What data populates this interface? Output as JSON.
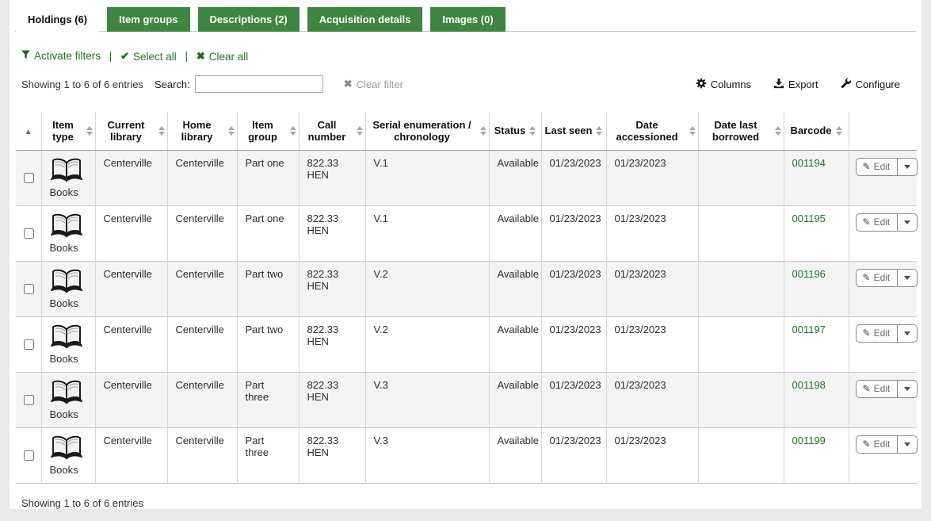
{
  "tabs": [
    {
      "label": "Holdings (6)",
      "active": true
    },
    {
      "label": "Item groups",
      "active": false
    },
    {
      "label": "Descriptions (2)",
      "active": false
    },
    {
      "label": "Acquisition details",
      "active": false
    },
    {
      "label": "Images (0)",
      "active": false
    }
  ],
  "filter_links": {
    "activate_filters": "Activate filters",
    "select_all": "Select all",
    "clear_all": "Clear all",
    "separator": "|"
  },
  "controls": {
    "showing": "Showing 1 to 6 of 6 entries",
    "search_label": "Search:",
    "search_value": "",
    "clear_filter": "Clear filter",
    "columns_button": "Columns",
    "export_button": "Export",
    "configure_button": "Configure"
  },
  "table": {
    "edit_label": "Edit",
    "columns": [
      "Item type",
      "Current library",
      "Home library",
      "Item group",
      "Call number",
      "Serial enumeration / chronology",
      "Status",
      "Last seen",
      "Date accessioned",
      "Date last borrowed",
      "Barcode"
    ],
    "rows": [
      {
        "item_type": "Books",
        "current_library": "Centerville",
        "home_library": "Centerville",
        "item_group": "Part one",
        "call_number": "822.33 HEN",
        "serial_enumeration": "V.1",
        "status": "Available",
        "last_seen": "01/23/2023",
        "date_accessioned": "01/23/2023",
        "date_last_borrowed": "",
        "barcode": "001194"
      },
      {
        "item_type": "Books",
        "current_library": "Centerville",
        "home_library": "Centerville",
        "item_group": "Part one",
        "call_number": "822.33 HEN",
        "serial_enumeration": "V.1",
        "status": "Available",
        "last_seen": "01/23/2023",
        "date_accessioned": "01/23/2023",
        "date_last_borrowed": "",
        "barcode": "001195"
      },
      {
        "item_type": "Books",
        "current_library": "Centerville",
        "home_library": "Centerville",
        "item_group": "Part two",
        "call_number": "822.33 HEN",
        "serial_enumeration": "V.2",
        "status": "Available",
        "last_seen": "01/23/2023",
        "date_accessioned": "01/23/2023",
        "date_last_borrowed": "",
        "barcode": "001196"
      },
      {
        "item_type": "Books",
        "current_library": "Centerville",
        "home_library": "Centerville",
        "item_group": "Part two",
        "call_number": "822.33 HEN",
        "serial_enumeration": "V.2",
        "status": "Available",
        "last_seen": "01/23/2023",
        "date_accessioned": "01/23/2023",
        "date_last_borrowed": "",
        "barcode": "001197"
      },
      {
        "item_type": "Books",
        "current_library": "Centerville",
        "home_library": "Centerville",
        "item_group": "Part three",
        "call_number": "822.33 HEN",
        "serial_enumeration": "V.3",
        "status": "Available",
        "last_seen": "01/23/2023",
        "date_accessioned": "01/23/2023",
        "date_last_borrowed": "",
        "barcode": "001198"
      },
      {
        "item_type": "Books",
        "current_library": "Centerville",
        "home_library": "Centerville",
        "item_group": "Part three",
        "call_number": "822.33 HEN",
        "serial_enumeration": "V.3",
        "status": "Available",
        "last_seen": "01/23/2023",
        "date_accessioned": "01/23/2023",
        "date_last_borrowed": "",
        "barcode": "001199"
      }
    ]
  },
  "footer": {
    "showing": "Showing 1 to 6 of 6 entries"
  },
  "icons": {
    "sort_ascending": "▲",
    "pencil": "✎",
    "check": "✔",
    "clear_x": "✖",
    "clear_filter_x": "✖"
  },
  "colors": {
    "tab_green": "#3E8642",
    "link_green": "#1c7a22",
    "sort_active_blue": "#3377b5",
    "row_stripe": "#f2f3f3"
  }
}
